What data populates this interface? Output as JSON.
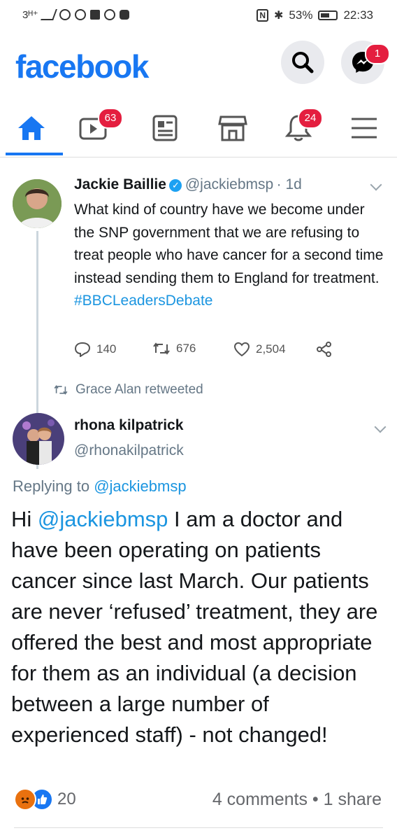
{
  "status_bar": {
    "network": "3ᴴ⁺",
    "battery_pct": "53%",
    "time": "22:33"
  },
  "header": {
    "logo": "facebook",
    "messenger_badge": "1"
  },
  "nav": {
    "watch_badge": "63",
    "notifications_badge": "24"
  },
  "tweet1": {
    "name": "Jackie Baillie",
    "handle": "@jackiebmsp",
    "age": "· 1d",
    "text": "What kind of country have we become under the SNP government that we are refusing to treat people who have cancer for a second time instead sending them to England for treatment.",
    "hashtag": "#BBCLeadersDebate",
    "replies": "140",
    "retweets": "676",
    "likes": "2,504"
  },
  "retweet_note": "Grace Alan retweeted",
  "tweet2": {
    "name": "rhona kilpatrick",
    "handle": "@rhonakilpatrick",
    "replying_prefix": "Replying to ",
    "replying_handle": "@jackiebmsp",
    "greeting": "Hi ",
    "mention": "@jackiebmsp",
    "text": " I am a doctor and have been operating on patients cancer since last March. Our patients are never ‘refused’ treatment, they are offered the best and most appropriate for them as an individual (a decision between a large number of experienced staff) - not changed!"
  },
  "post_footer": {
    "reaction_count": "20",
    "comments_shares": "4 comments • 1 share"
  },
  "colors": {
    "brand": "#1877f2",
    "badge": "#e41e3f",
    "link": "#1b95e0"
  }
}
